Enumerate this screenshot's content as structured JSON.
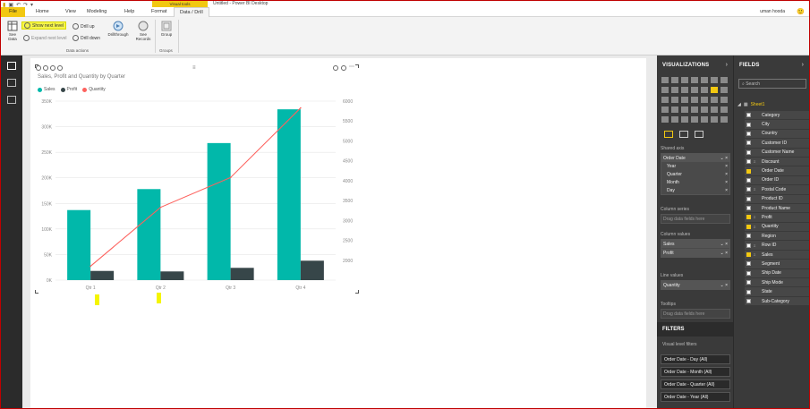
{
  "window": {
    "title": "Untitled - Power BI Desktop",
    "context_tab_group": "Visual tools",
    "user": "uman hooda"
  },
  "tabs": [
    "File",
    "Home",
    "View",
    "Modeling",
    "Help",
    "Format",
    "Data / Drill"
  ],
  "ribbon": {
    "see_data": "See Data",
    "show_next_level": "Show next level",
    "expand_next_level": "Expand next level",
    "drill_up": "Drill up",
    "drill_down": "Drill down",
    "drillthrough": "Drillthrough",
    "see_records": "See Records",
    "group": "Group",
    "group_label_data_actions": "Data actions",
    "group_label_groups": "Groups"
  },
  "chart_data": {
    "type": "bar",
    "title": "Sales, Profit and Quantity by Quarter",
    "categories": [
      "Qtr 1",
      "Qtr 2",
      "Qtr 3",
      "Qtr 4"
    ],
    "series": [
      {
        "name": "Sales",
        "kind": "bar",
        "axis": "left",
        "color": "#01b8aa",
        "values": [
          137000,
          178000,
          268000,
          334000
        ]
      },
      {
        "name": "Profit",
        "kind": "bar",
        "axis": "left",
        "color": "#374649",
        "values": [
          18000,
          17000,
          24000,
          38000
        ]
      },
      {
        "name": "Quantity",
        "kind": "line",
        "axis": "right",
        "color": "#fd625e",
        "values": [
          1850,
          3330,
          4080,
          5830
        ]
      }
    ],
    "y_left": {
      "ticks": [
        "0K",
        "50K",
        "100K",
        "150K",
        "200K",
        "250K",
        "300K",
        "350K"
      ],
      "min": 0,
      "max": 350000
    },
    "y_right": {
      "ticks": [
        "2000",
        "2500",
        "3000",
        "3500",
        "4000",
        "4500",
        "5000",
        "5500",
        "6000"
      ],
      "min": 1500,
      "max": 6000
    },
    "legend_position": "top-left",
    "grid": true
  },
  "visualizations": {
    "header": "VISUALIZATIONS",
    "shared_axis_label": "Shared axis",
    "shared_axis_field": "Order Date",
    "hierarchy": [
      "Year",
      "Quarter",
      "Month",
      "Day"
    ],
    "column_series_label": "Column series",
    "column_series_hint": "Drag data fields here",
    "column_values_label": "Column values",
    "column_values": [
      "Sales",
      "Profit"
    ],
    "line_values_label": "Line values",
    "line_values": [
      "Quantity"
    ],
    "tooltips_label": "Tooltips",
    "tooltips_hint": "Drag data fields here"
  },
  "filters": {
    "header": "FILTERS",
    "sub": "Visual level filters",
    "items": [
      "Order Date - Day (All)",
      "Order Date - Month (All)",
      "Order Date - Quarter (All)",
      "Order Date - Year (All)"
    ]
  },
  "fields": {
    "header": "FIELDS",
    "search_placeholder": "Search",
    "table": "Sheet1",
    "items": [
      {
        "name": "Category",
        "checked": false,
        "sigma": false
      },
      {
        "name": "City",
        "checked": false,
        "sigma": false
      },
      {
        "name": "Country",
        "checked": false,
        "sigma": false
      },
      {
        "name": "Customer ID",
        "checked": false,
        "sigma": false
      },
      {
        "name": "Customer Name",
        "checked": false,
        "sigma": false
      },
      {
        "name": "Discount",
        "checked": false,
        "sigma": true
      },
      {
        "name": "Order Date",
        "checked": true,
        "sigma": false
      },
      {
        "name": "Order ID",
        "checked": false,
        "sigma": false
      },
      {
        "name": "Postal Code",
        "checked": false,
        "sigma": true
      },
      {
        "name": "Product ID",
        "checked": false,
        "sigma": false
      },
      {
        "name": "Product Name",
        "checked": false,
        "sigma": false
      },
      {
        "name": "Profit",
        "checked": true,
        "sigma": true
      },
      {
        "name": "Quantity",
        "checked": true,
        "sigma": true
      },
      {
        "name": "Region",
        "checked": false,
        "sigma": false
      },
      {
        "name": "Row ID",
        "checked": false,
        "sigma": true
      },
      {
        "name": "Sales",
        "checked": true,
        "sigma": true
      },
      {
        "name": "Segment",
        "checked": false,
        "sigma": false
      },
      {
        "name": "Ship Date",
        "checked": false,
        "sigma": false
      },
      {
        "name": "Ship Mode",
        "checked": false,
        "sigma": false
      },
      {
        "name": "State",
        "checked": false,
        "sigma": false
      },
      {
        "name": "Sub-Category",
        "checked": false,
        "sigma": false
      }
    ]
  }
}
